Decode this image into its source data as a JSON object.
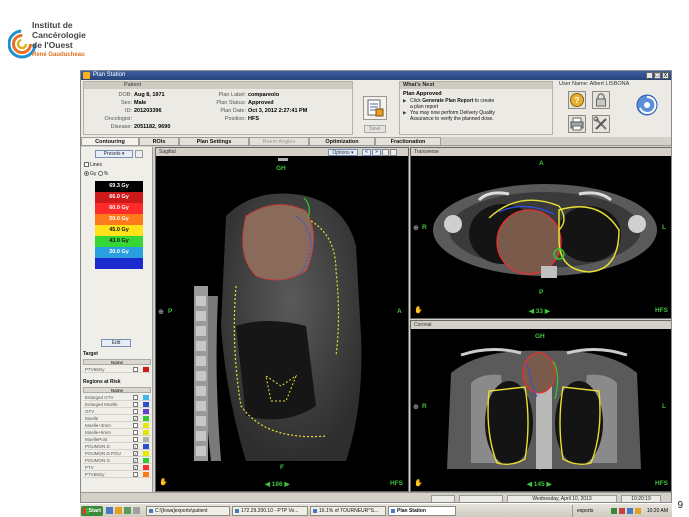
{
  "logo": {
    "line1": "Institut de",
    "line2": "Cancérologie",
    "line3": "de l'Ouest",
    "line4": "René Gauducheau"
  },
  "page_number": "9",
  "window": {
    "title": "Plan Station",
    "controls": [
      "_",
      "□",
      "X"
    ]
  },
  "patient": {
    "header": "Patient",
    "dob_label": "DOB:",
    "dob": "Aug 8, 1971",
    "sex_label": "Sex:",
    "sex": "Male",
    "id_label": "ID:",
    "id": "201203396",
    "oncologist_label": "Oncologist:",
    "oncologist": "",
    "disease_label": "Disease:",
    "disease": "2051182, 9690",
    "plan_label_label": "Plan Label:",
    "plan_label": "compareolo",
    "plan_status_label": "Plan Status:",
    "plan_status": "Approved",
    "plan_date_label": "Plan Date:",
    "plan_date": "Oct 3, 2012 2:27:41 PM",
    "position_label": "Position:",
    "position": "HFS"
  },
  "save_label": "Save",
  "whats_next": {
    "header": "What's Next",
    "status": "Plan Approved",
    "line1a": "Click ",
    "line1b": "Generate Plan Report",
    "line1c": " to create",
    "line1d": "a plan report",
    "line2a": "You may now perform Delivery Quality",
    "line2b": "Assurance to verify the planned dose."
  },
  "user": {
    "label": "User Name: Albert LISBONA"
  },
  "tabs": [
    {
      "label": "Contouring"
    },
    {
      "label": "ROIs"
    },
    {
      "label": "Plan Settings"
    },
    {
      "label": "Beam Angles"
    },
    {
      "label": "Optimization"
    },
    {
      "label": "Fractionation"
    }
  ],
  "sidebar": {
    "presets": "Presets ▾",
    "lines": "Lines",
    "gy": "Gy",
    "pct": "%",
    "edit": "Edit",
    "target_title": "Target",
    "regions_title": "Regions at Risk",
    "name_header": "Name"
  },
  "dose_levels": [
    {
      "label": "69.3 Gy",
      "color": "#000000"
    },
    {
      "label": "66.0 Gy",
      "color": "#cc1a1a"
    },
    {
      "label": "60.0 Gy",
      "color": "#ff2a2a"
    },
    {
      "label": "50.0 Gy",
      "color": "#ff7a1a"
    },
    {
      "label": "45.0 Gy",
      "color": "#ffe21a"
    },
    {
      "label": "43.0 Gy",
      "color": "#37d637"
    },
    {
      "label": "20.0 Gy",
      "color": "#2a9fe0"
    },
    {
      "label": "",
      "color": "#1a2acc"
    }
  ],
  "targets": [
    {
      "name": "PTV66Gy",
      "checked": "",
      "color": "#cc1a1a"
    }
  ],
  "regions": [
    {
      "name": "Enlarged GTV",
      "checked": "",
      "color": "#3fb8e8"
    },
    {
      "name": "Enlarged Moelle",
      "checked": "",
      "color": "#2a52c8"
    },
    {
      "name": "GTV",
      "checked": "",
      "color": "#6a3ec8"
    },
    {
      "name": "Moelle",
      "checked": "✓",
      "color": "#37c837"
    },
    {
      "name": "Moelle+3mm",
      "checked": "",
      "color": "#e6e600"
    },
    {
      "name": "Moelle+6mm",
      "checked": "",
      "color": "#e6e600"
    },
    {
      "name": "MoellePost",
      "checked": "",
      "color": "#b0b0b0"
    },
    {
      "name": "POUMON D",
      "checked": "✓",
      "color": "#2a52c8"
    },
    {
      "name": "POUMON D POU",
      "checked": "✓",
      "color": "#e8e800"
    },
    {
      "name": "POUMON G",
      "checked": "✓",
      "color": "#37c837"
    },
    {
      "name": "PTV",
      "checked": "✓",
      "color": "#ff2a2a"
    },
    {
      "name": "PTV66Gy",
      "checked": "",
      "color": "#ff7a1a"
    }
  ],
  "sagittal": {
    "title": "Sagittal",
    "options": "Options ▾",
    "top": "GH",
    "left": "P",
    "right": "A",
    "bottom": "F",
    "orientation": "HFS",
    "slice": "◀ 186 ▶"
  },
  "transverse": {
    "title": "Transverse",
    "top": "A",
    "left": "R",
    "right": "L",
    "bottom": "P",
    "orientation": "HFS",
    "slice": "◀ 33 ▶"
  },
  "coronal": {
    "title": "Coronal",
    "top": "GH",
    "left": "R",
    "right": "L",
    "bottom": "F",
    "orientation": "HFS",
    "slice": "◀ 145 ▶"
  },
  "statusbar": {
    "date": "Wednesday, April 10, 2013",
    "time": "10:20:19"
  },
  "taskbar": {
    "start": "Start",
    "tasks": [
      {
        "label": "C:\\[Iowa]exports\\patient"
      },
      {
        "label": "172.29.200.10 - PTP Vo..."
      },
      {
        "label": "16.1% of TOURNEUR^S..."
      },
      {
        "label": "Plan Station"
      }
    ],
    "tray_label": "exports",
    "clock": "10:20 AM"
  }
}
